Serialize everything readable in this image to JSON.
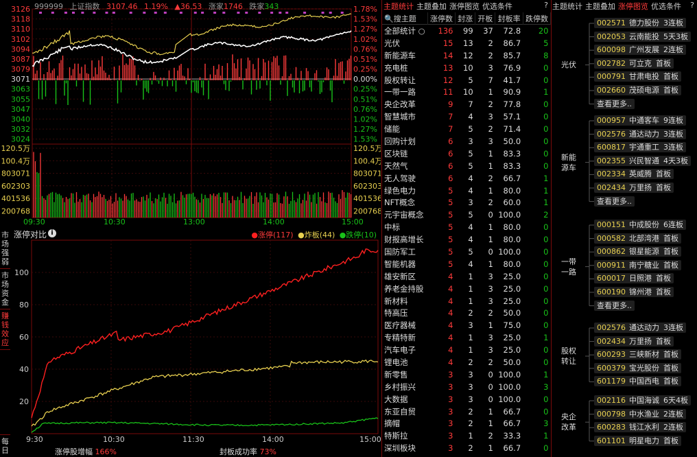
{
  "minute": {
    "code": "999999",
    "name": "上证指数",
    "price": "3107.46",
    "pct": "1.19%",
    "chg": "▲36.53",
    "up_label": "涨家",
    "up_count": "1746",
    "down_label": "跌家",
    "down_count": "343",
    "price_ticks": [
      "3126",
      "3118",
      "3110",
      "3102",
      "3094",
      "3087",
      "3079",
      "3071",
      "3063",
      "3055",
      "3047",
      "3040",
      "3032",
      "3024"
    ],
    "pct_ticks": [
      "1.78%",
      "1.53%",
      "1.27%",
      "1.02%",
      "0.76%",
      "0.51%",
      "0.25%",
      "0.00%",
      "0.25%",
      "0.51%",
      "0.76%",
      "1.02%",
      "1.27%",
      "1.53%"
    ],
    "vol_ticks": [
      "120.5万",
      "100.4万",
      "803071",
      "602303",
      "401536",
      "200768"
    ],
    "time_ticks": [
      "09:30",
      "10:30",
      "13:00",
      "14:00",
      "15:00"
    ]
  },
  "compare": {
    "title": "涨停对比",
    "legend": [
      {
        "label": "涨停(117)",
        "color": "#ff2020"
      },
      {
        "label": "炸板(44)",
        "color": "#e8d050"
      },
      {
        "label": "跌停(10)",
        "color": "#19c219"
      }
    ],
    "y_ticks": [
      "100",
      "80",
      "60",
      "40",
      "20"
    ],
    "x_ticks": [
      "9:30",
      "10:30",
      "11:30",
      "14:00",
      "15:00"
    ],
    "footer_left_label": "涨停股增幅",
    "footer_left_value": "166%",
    "footer_right_label": "封板成功率",
    "footer_right_value": "73%"
  },
  "side_tabs": [
    "市场强弱",
    "市场资金",
    "赚钱效应",
    "每日"
  ],
  "theme": {
    "tabs": [
      "主题统计",
      "主题叠加",
      "涨停图览",
      "优选条件"
    ],
    "active_tab": 0,
    "help": "?",
    "columns": [
      "搜主题",
      "涨停数",
      "封涨",
      "开板",
      "封板率",
      "跌停数"
    ],
    "rows": [
      [
        "全部统计",
        "136",
        "99",
        "37",
        "72.8",
        "20"
      ],
      [
        "光伏",
        "15",
        "13",
        "2",
        "86.7",
        "5"
      ],
      [
        "新能源车",
        "14",
        "12",
        "2",
        "85.7",
        "8"
      ],
      [
        "充电桩",
        "13",
        "10",
        "3",
        "76.9",
        "0"
      ],
      [
        "股权转让",
        "12",
        "5",
        "7",
        "41.7",
        "0"
      ],
      [
        "一带一路",
        "11",
        "10",
        "1",
        "90.9",
        "1"
      ],
      [
        "央企改革",
        "9",
        "7",
        "2",
        "77.8",
        "0"
      ],
      [
        "智慧城市",
        "7",
        "4",
        "3",
        "57.1",
        "0"
      ],
      [
        "储能",
        "7",
        "5",
        "2",
        "71.4",
        "0"
      ],
      [
        "回购计划",
        "6",
        "3",
        "3",
        "50.0",
        "0"
      ],
      [
        "区块链",
        "6",
        "5",
        "1",
        "83.3",
        "0"
      ],
      [
        "天然气",
        "6",
        "5",
        "1",
        "83.3",
        "0"
      ],
      [
        "无人驾驶",
        "6",
        "4",
        "2",
        "66.7",
        "1"
      ],
      [
        "绿色电力",
        "5",
        "4",
        "1",
        "80.0",
        "1"
      ],
      [
        "NFT概念",
        "5",
        "3",
        "2",
        "60.0",
        "1"
      ],
      [
        "元宇宙概念",
        "5",
        "5",
        "0",
        "100.0",
        "2"
      ],
      [
        "中标",
        "5",
        "4",
        "1",
        "80.0",
        "0"
      ],
      [
        "财报高增长",
        "5",
        "4",
        "1",
        "80.0",
        "0"
      ],
      [
        "国防军工",
        "5",
        "5",
        "0",
        "100.0",
        "0"
      ],
      [
        "智能机器",
        "5",
        "4",
        "1",
        "80.0",
        "0"
      ],
      [
        "雄安新区",
        "4",
        "1",
        "3",
        "25.0",
        "0"
      ],
      [
        "养老金持股",
        "4",
        "1",
        "3",
        "25.0",
        "0"
      ],
      [
        "新材料",
        "4",
        "1",
        "3",
        "25.0",
        "0"
      ],
      [
        "特高压",
        "4",
        "2",
        "2",
        "50.0",
        "0"
      ],
      [
        "医疗器械",
        "4",
        "3",
        "1",
        "75.0",
        "0"
      ],
      [
        "专精特新",
        "4",
        "1",
        "3",
        "25.0",
        "1"
      ],
      [
        "汽车电子",
        "4",
        "1",
        "3",
        "25.0",
        "0"
      ],
      [
        "锂电池",
        "4",
        "2",
        "2",
        "50.0",
        "0"
      ],
      [
        "新零售",
        "3",
        "3",
        "0",
        "100.0",
        "1"
      ],
      [
        "乡村振兴",
        "3",
        "3",
        "0",
        "100.0",
        "3"
      ],
      [
        "大数据",
        "3",
        "3",
        "0",
        "100.0",
        "0"
      ],
      [
        "东亚自贸",
        "3",
        "2",
        "1",
        "66.7",
        "0"
      ],
      [
        "摘帽",
        "3",
        "2",
        "1",
        "66.7",
        "3"
      ],
      [
        "特斯拉",
        "3",
        "1",
        "2",
        "33.3",
        "1"
      ],
      [
        "深圳板块",
        "3",
        "2",
        "1",
        "66.7",
        "0"
      ]
    ]
  },
  "stocks": {
    "tabs": [
      "主题统计",
      "主题叠加",
      "涨停图览",
      "优选条件"
    ],
    "active_tab": 2,
    "help": "?",
    "more_label": "查看更多..",
    "groups": [
      {
        "label": "光伏",
        "items": [
          [
            "002571",
            "德力股份",
            "3连板"
          ],
          [
            "002053",
            "云南能投",
            "5天3板"
          ],
          [
            "600098",
            "广州发展",
            "2连板"
          ],
          [
            "002782",
            "可立克",
            "首板"
          ],
          [
            "000791",
            "甘肃电投",
            "首板"
          ],
          [
            "002660",
            "茂硕电源",
            "首板"
          ]
        ]
      },
      {
        "label": "新能源车",
        "items": [
          [
            "000957",
            "中通客车",
            "9连板"
          ],
          [
            "002576",
            "通达动力",
            "3连板"
          ],
          [
            "600817",
            "宇通重工",
            "3连板"
          ],
          [
            "002355",
            "兴民智通",
            "4天3板"
          ],
          [
            "002334",
            "英威腾",
            "首板"
          ],
          [
            "002434",
            "万里扬",
            "首板"
          ]
        ]
      },
      {
        "label": "一带一路",
        "items": [
          [
            "000151",
            "中成股份",
            "6连板"
          ],
          [
            "000582",
            "北部湾港",
            "首板"
          ],
          [
            "000862",
            "银星能源",
            "首板"
          ],
          [
            "000911",
            "南宁糖业",
            "首板"
          ],
          [
            "600017",
            "日照港",
            "首板"
          ],
          [
            "600190",
            "锦州港",
            "首板"
          ]
        ]
      },
      {
        "label": "股权转让",
        "items": [
          [
            "002576",
            "通达动力",
            "3连板"
          ],
          [
            "002434",
            "万里扬",
            "首板"
          ],
          [
            "600293",
            "三峡新材",
            "首板"
          ],
          [
            "600379",
            "宝光股份",
            "首板"
          ],
          [
            "601179",
            "中国西电",
            "首板"
          ]
        ]
      },
      {
        "label": "央企改革",
        "items": [
          [
            "002116",
            "中国海诚",
            "6天4板"
          ],
          [
            "000798",
            "中水渔业",
            "2连板"
          ],
          [
            "600283",
            "钱江水利",
            "2连板"
          ],
          [
            "601101",
            "明星电力",
            "首板"
          ]
        ]
      }
    ]
  }
}
